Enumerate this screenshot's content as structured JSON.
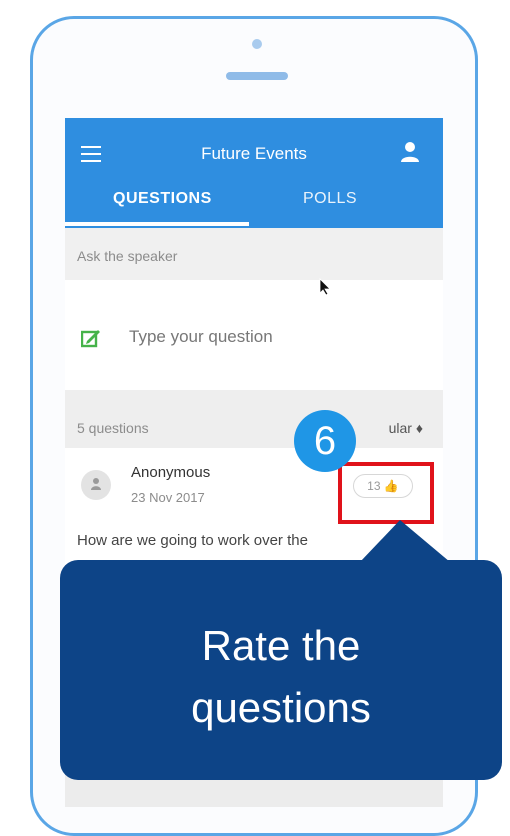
{
  "app": {
    "title": "Future Events"
  },
  "tabs": [
    {
      "label": "QUESTIONS"
    },
    {
      "label": "POLLS"
    }
  ],
  "ask": {
    "header": "Ask the speaker",
    "placeholder": "Type your question"
  },
  "list": {
    "count": "5 questions",
    "sort_label": "ular"
  },
  "question": {
    "author": "Anonymous",
    "date": "23 Nov 2017",
    "likes": "13",
    "text": "How are we going to work over the"
  },
  "annotation": {
    "step": "6",
    "callout_line1": "Rate the",
    "callout_line2": "questions"
  },
  "icons": {
    "menu": "menu-icon",
    "user": "user-icon",
    "edit": "edit-icon",
    "like": "thumbs-up-icon",
    "sort": "sort-icon"
  },
  "colors": {
    "appbar": "#2f8ee0",
    "phone_frame": "#5aa6e6",
    "edit_icon": "#46b34a",
    "highlight": "#e0121a",
    "step_badge": "#1f96e6",
    "callout": "#0d4487"
  }
}
